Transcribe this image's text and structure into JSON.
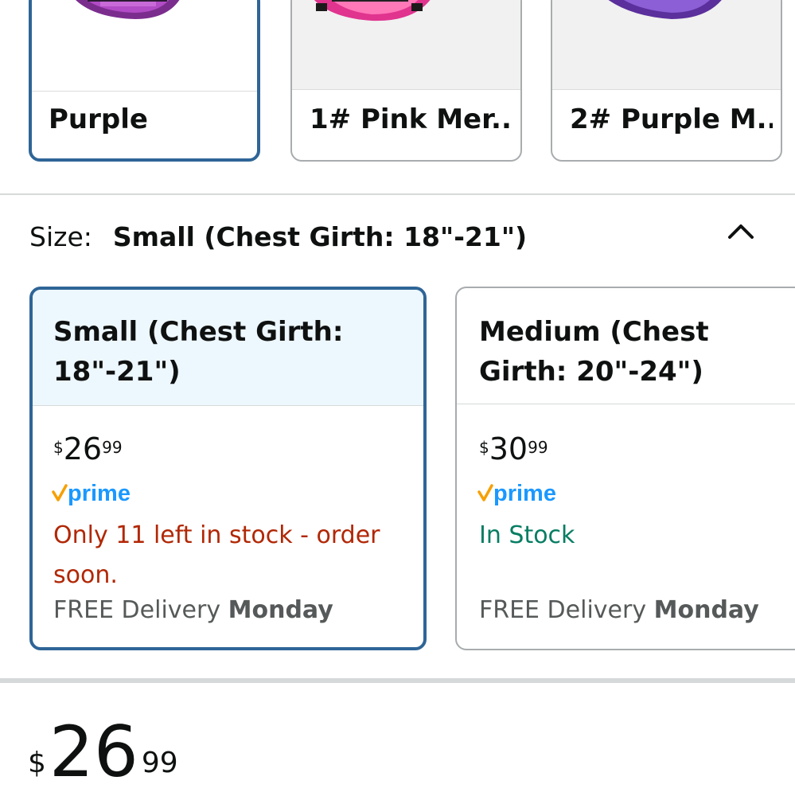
{
  "colors": {
    "accent_border": "#2f6597",
    "selected_header_bg": "#edf7fe",
    "prime_blue": "#1a98ff",
    "prime_check": "#f7a000",
    "low_stock": "#b12704",
    "in_stock": "#067d62",
    "muted_text": "#565959"
  },
  "color_options": [
    {
      "label": "Purple",
      "selected": true
    },
    {
      "label": "1# Pink Mer...",
      "selected": false
    },
    {
      "label": "2# Purple M...",
      "selected": false
    }
  ],
  "size_selector": {
    "label": "Size:",
    "selected_value": "Small (Chest Girth: 18\"-21\")",
    "collapse_icon": "chevron-up-icon"
  },
  "size_options": [
    {
      "title": "Small (Chest Girth: 18\"-21\")",
      "currency": "$",
      "price_whole": "26",
      "price_fraction": "99",
      "prime_label": "prime",
      "stock_text": "Only 11 left in stock - order soon.",
      "delivery_prefix": "FREE Delivery",
      "delivery_day": "Monday",
      "selected": true
    },
    {
      "title": "Medium (Chest Girth: 20\"-24\")",
      "currency": "$",
      "price_whole": "30",
      "price_fraction": "99",
      "prime_label": "prime",
      "stock_text": "In Stock",
      "delivery_prefix": "FREE Delivery",
      "delivery_day": "Monday",
      "selected": false
    }
  ],
  "main_price": {
    "currency": "$",
    "whole": "26",
    "fraction": "99"
  }
}
